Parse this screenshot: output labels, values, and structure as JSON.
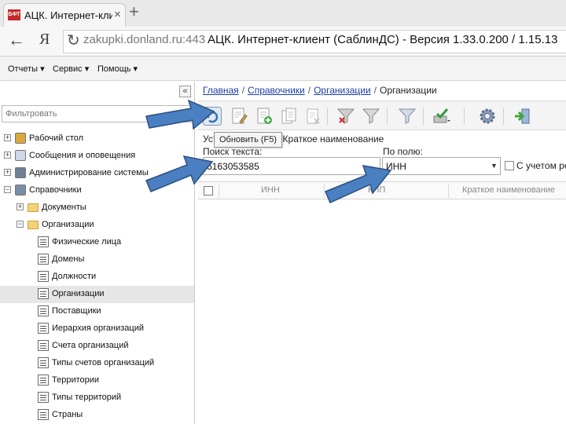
{
  "browser": {
    "tab_title": "АЦК. Интернет-клиен",
    "tab_favicon_text": "БФТ",
    "new_tab_label": "+",
    "url_host": "zakupki.donland.ru:443",
    "page_title": "АЦК. Интернет-клиент (СаблинДС) - Версия 1.33.0.200 / 1.15.13",
    "yandex_logo": "Я"
  },
  "app_menu": [
    {
      "label": "Отчеты"
    },
    {
      "label": "Сервис"
    },
    {
      "label": "Помощь"
    }
  ],
  "sidebar": {
    "collapse_label": "«",
    "filter_placeholder": "Фильтровать",
    "tree": [
      {
        "label": "Рабочий стол",
        "expander": "+",
        "icon": "desktop-icon"
      },
      {
        "label": "Сообщения и оповещения",
        "expander": "+",
        "icon": "envelope-icon"
      },
      {
        "label": "Администрирование системы",
        "expander": "+",
        "icon": "admin-icon"
      },
      {
        "label": "Справочники",
        "expander": "−",
        "icon": "book-icon"
      },
      {
        "label": "Документы",
        "expander": "+",
        "icon": "folder-icon"
      },
      {
        "label": "Организации",
        "expander": "−",
        "icon": "folder-open-icon"
      },
      {
        "label": "Физические лица",
        "icon": "list-icon"
      },
      {
        "label": "Домены",
        "icon": "list-icon"
      },
      {
        "label": "Должности",
        "icon": "list-icon"
      },
      {
        "label": "Организации",
        "icon": "list-icon",
        "selected": true
      },
      {
        "label": "Поставщики",
        "icon": "list-icon"
      },
      {
        "label": "Иерархия организаций",
        "icon": "list-icon"
      },
      {
        "label": "Счета организаций",
        "icon": "list-icon"
      },
      {
        "label": "Типы счетов организаций",
        "icon": "list-icon"
      },
      {
        "label": "Территории",
        "icon": "list-icon"
      },
      {
        "label": "Типы территорий",
        "icon": "list-icon"
      },
      {
        "label": "Страны",
        "icon": "list-icon"
      }
    ]
  },
  "breadcrumb": {
    "items": [
      "Главная",
      "Справочники",
      "Организации"
    ],
    "current": "Организации",
    "separator": "/"
  },
  "toolbar": {
    "refresh_tooltip": "Обновить (F5)",
    "tools": [
      "refresh-icon",
      "edit-doc-icon",
      "add-doc-icon",
      "copy-doc-icon",
      "delete-doc-icon",
      "filter-clear-icon",
      "filter-icon",
      "filter-apply-icon",
      "approve-icon",
      "settings-gear-icon",
      "exit-icon"
    ]
  },
  "sort_text": "Уст      р: Состояние, Краткое наименование",
  "search": {
    "label": "Поиск текста:",
    "value": "6163053585",
    "field_label": "По полю:",
    "field_value": "ИНН",
    "case_label": "С учетом ре"
  },
  "grid": {
    "columns": [
      "ИНН",
      "КПП",
      "Краткое наименование"
    ]
  },
  "colors": {
    "arrow_fill": "#4a7fc1",
    "arrow_stroke": "#2b4f80",
    "link": "#1a3fa0",
    "selected_row": "#e6e6e6"
  }
}
